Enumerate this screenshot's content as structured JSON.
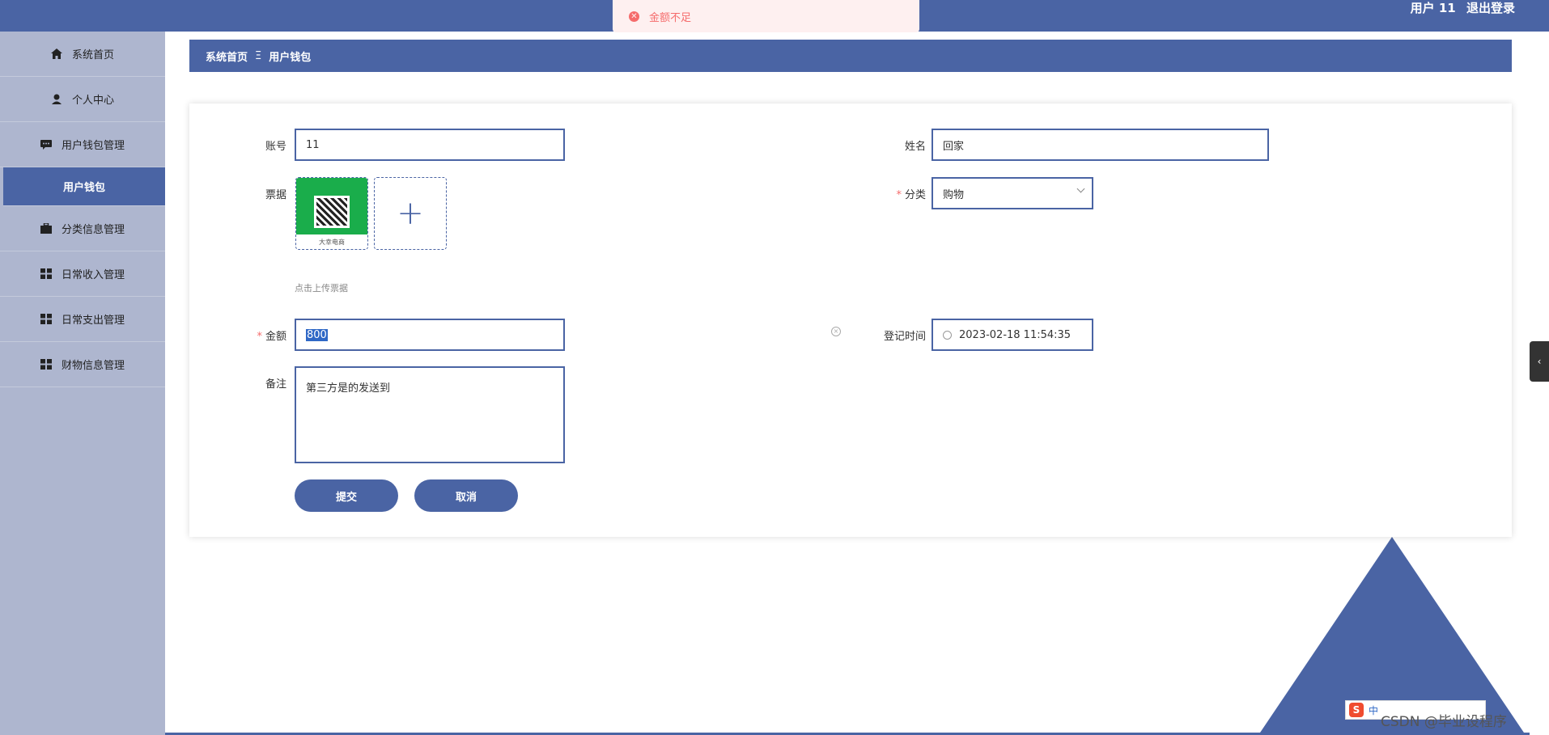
{
  "header": {
    "username": "用户 11",
    "logout_label": "退出登录"
  },
  "toast": {
    "message": "金额不足",
    "type": "error"
  },
  "sidebar": {
    "items": [
      {
        "label": "系统首页",
        "icon": "home-icon"
      },
      {
        "label": "个人中心",
        "icon": "user-icon"
      },
      {
        "label": "用户钱包管理",
        "icon": "message-icon"
      },
      {
        "label": "用户钱包",
        "icon": "",
        "active": true
      },
      {
        "label": "分类信息管理",
        "icon": "briefcase-icon"
      },
      {
        "label": "日常收入管理",
        "icon": "grid-icon"
      },
      {
        "label": "日常支出管理",
        "icon": "grid-icon"
      },
      {
        "label": "财物信息管理",
        "icon": "grid-icon"
      }
    ]
  },
  "breadcrumb": {
    "home": "系统首页",
    "separator": "Ξ",
    "current": "用户钱包"
  },
  "form": {
    "account_label": "账号",
    "account_value": "11",
    "name_label": "姓名",
    "name_value": "回家",
    "receipt_label": "票据",
    "receipt_caption": "大幸电商",
    "upload_tip": "点击上传票据",
    "category_label": "分类",
    "category_value": "购物",
    "amount_label": "金额",
    "amount_value": "800",
    "time_label": "登记时间",
    "time_value": "2023-02-18 11:54:35",
    "remark_label": "备注",
    "remark_value": "第三方是的发送到",
    "submit_label": "提交",
    "cancel_label": "取消"
  },
  "ime": {
    "label": "中"
  },
  "watermark": "CSDN @毕业设程序",
  "colors": {
    "primary": "#4a64a4",
    "sidebar": "#aeb6cf",
    "error": "#f56c6c",
    "toast_bg": "#fef0f0"
  }
}
